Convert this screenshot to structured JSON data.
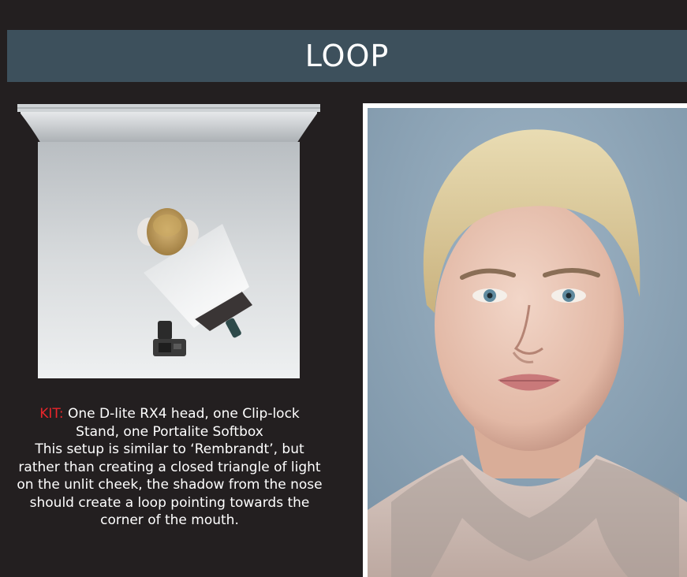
{
  "header": {
    "title": "LOOP"
  },
  "caption": {
    "kit_label": "KIT:",
    "kit_text": " One D-lite RX4 head, one Clip-lock",
    "kit_text_2": "Stand, one Portalite Softbox",
    "body_lines": [
      "This setup is similar to ‘Rembrandt’, but",
      "rather than creating a closed triangle of light",
      "on the unlit cheek, the shadow from the nose",
      "should create a loop pointing towards the",
      "corner of the mouth."
    ]
  },
  "colors": {
    "background": "#231f20",
    "banner": "#3d505c",
    "accent_red": "#e8262b",
    "text": "#ffffff"
  }
}
